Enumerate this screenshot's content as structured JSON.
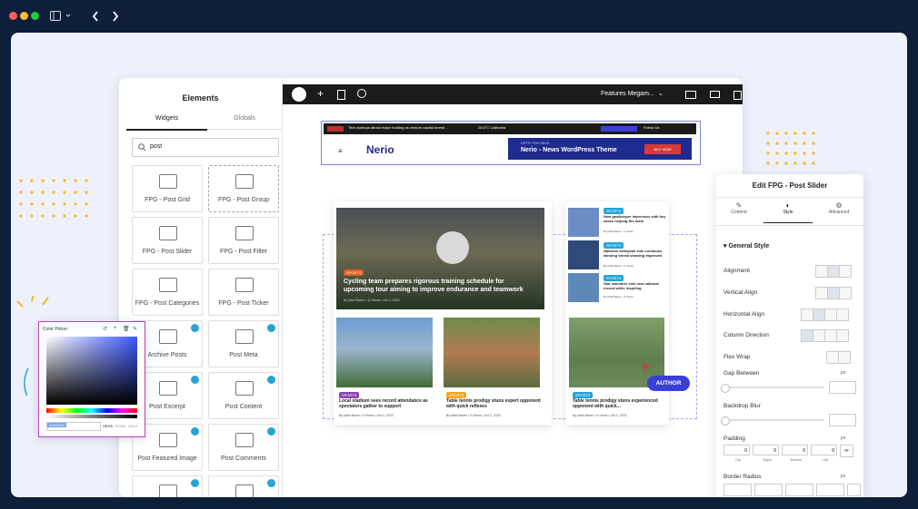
{
  "window": {
    "dots": [
      "#ff5f57",
      "#febc2e",
      "#28c840"
    ]
  },
  "elements_panel": {
    "title": "Elements",
    "tabs": [
      "Widgets",
      "Globals"
    ],
    "search_value": "post",
    "widgets": [
      {
        "label": "FPG - Post Grid"
      },
      {
        "label": "FPG - Post Group"
      },
      {
        "label": "FPG - Post Slider"
      },
      {
        "label": "FPG - Post Filter"
      },
      {
        "label": "FPG - Post Categories"
      },
      {
        "label": "FPG - Post Ticker"
      },
      {
        "label": "Archive Posts"
      },
      {
        "label": "Post Meta"
      },
      {
        "label": "Post Excerpt"
      },
      {
        "label": "Post Content"
      },
      {
        "label": "Post Featured Image"
      },
      {
        "label": "Post Comments"
      }
    ]
  },
  "editor_bar": {
    "page_select": "Features Megam..."
  },
  "site_header": {
    "logo": "Nerio",
    "promo_small": "UPTO 70% SALE",
    "promo_title": "Nerio - News WordPress Theme",
    "promo_button": "BUY NOW",
    "ticker": "Tech startups attract major funding as venture capital investi...",
    "weather": "28.0°C  California",
    "follow": "Follow Us"
  },
  "featured": {
    "tag": "SPORTS",
    "title": "Cycling team prepares rigorous training schedule for upcoming tour aiming to improve endurance and teamwork",
    "meta": "By Adell Bauer  •  12 Views  •  Oct 2, 2023"
  },
  "grid_posts": [
    {
      "tag": "SPORTS",
      "title": "Local stadium sees record attendance as spectators gather to support",
      "meta": "By Adell Bauer  •  5 Views  •  Oct 2, 2023"
    },
    {
      "tag": "SPORTS",
      "title": "Table tennis prodigy stuns expert opponent with quick reflexes",
      "meta": "By Adell Bauer  •  9 Views  •  Oct 2, 2023"
    }
  ],
  "side_posts": [
    {
      "tag": "SPORTS",
      "title": "New goalkeeper impresses with key saves helping the team",
      "meta": "By Adell Bauer  •  4 Views"
    },
    {
      "tag": "SPORTS",
      "title": "National volleyball side continues winning streak showing improved",
      "meta": "By Adell Bauer  •  2 Views"
    },
    {
      "tag": "SPORTS",
      "title": "Star swimmer sets new national record while inspiring",
      "meta": "By Adell Bauer  •  3 Views"
    }
  ],
  "right_post": {
    "tag": "SPORTS",
    "title": "Table tennis prodigy stuns experienced opponent with quick...",
    "meta": "By Adell Bauer  •  6 Views  •  Oct 2, 2023"
  },
  "author_badge": "AUTHOR",
  "color_picker": {
    "title": "Color Picker",
    "hex": "#A0A0A0",
    "modes": [
      "HEXA",
      "RGBA",
      "HSLA"
    ]
  },
  "style_panel": {
    "title": "Edit FPG - Post Slider",
    "tabs": [
      "Content",
      "Style",
      "Advanced"
    ],
    "section": "General Style",
    "rows": [
      "Alignment",
      "Vertical Align",
      "Horizontal Align",
      "Column Direction",
      "Flex Wrap",
      "Gap Between",
      "Backdrop Blur",
      "Padding",
      "Border Radius"
    ],
    "unit": "px",
    "padding_values": [
      "0",
      "0",
      "0",
      "0"
    ],
    "padding_labels": [
      "Top",
      "Right",
      "Bottom",
      "Left"
    ]
  },
  "colors": {
    "accent": "#3b3fd8",
    "brand": "#1e2b8f",
    "dark": "#1a1a1a",
    "cyan": "#25a4d6"
  }
}
